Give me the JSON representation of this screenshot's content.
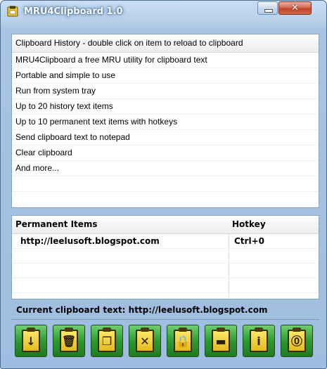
{
  "window": {
    "title": "MRU4Clipboard 1.0",
    "close_label": "✕"
  },
  "history": {
    "header": "Clipboard History - double click on item to reload to clipboard",
    "items": [
      "MRU4Clipboard a free MRU utility for clipboard text",
      "Portable and simple to use",
      "Run from system tray",
      "Up to 20 history text items",
      "Up to 10 permanent text items with hotkeys",
      "Send clipboard text to notepad",
      "Clear clipboard",
      "And more...",
      "",
      ""
    ]
  },
  "permanent": {
    "col_items": "Permanent Items",
    "col_hotkey": "Hotkey",
    "rows": [
      {
        "item": "http://leelusoft.blogspot.com",
        "hotkey": "Ctrl+0"
      },
      {
        "item": "",
        "hotkey": ""
      },
      {
        "item": "",
        "hotkey": ""
      },
      {
        "item": "",
        "hotkey": ""
      }
    ]
  },
  "status": {
    "current_text": "Current clipboard text: http://leelusoft.blogspot.com"
  },
  "toolbar": {
    "buttons": [
      {
        "icon": "clipboard-load-icon",
        "glyph": "↓"
      },
      {
        "icon": "clipboard-delete-icon",
        "glyph": "🗑"
      },
      {
        "icon": "clipboard-copy-icon",
        "glyph": "❐"
      },
      {
        "icon": "clipboard-clear-icon",
        "glyph": "✕"
      },
      {
        "icon": "clipboard-lock-icon",
        "glyph": "🔒"
      },
      {
        "icon": "clipboard-notepad-icon",
        "glyph": "▬"
      },
      {
        "icon": "clipboard-info-icon",
        "glyph": "i"
      },
      {
        "icon": "clipboard-about-icon",
        "glyph": "⓪"
      }
    ]
  },
  "colors": {
    "frame": "#a9c4e3",
    "button_green": "#2f9a2f",
    "clip_yellow": "#f0cf3a",
    "close_red": "#c4422a"
  }
}
